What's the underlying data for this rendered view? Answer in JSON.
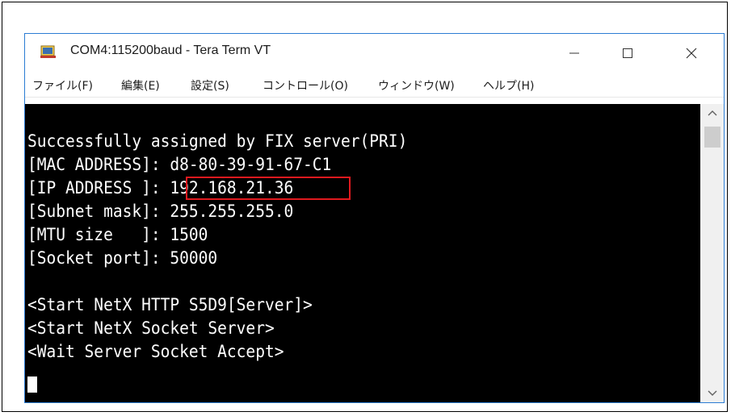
{
  "window": {
    "title": "COM4:115200baud - Tera Term VT"
  },
  "menu": {
    "items": [
      {
        "label": "ファイル(F)"
      },
      {
        "label": "編集(E)"
      },
      {
        "label": "設定(S)"
      },
      {
        "label": "コントロール(O)"
      },
      {
        "label": "ウィンドウ(W)"
      },
      {
        "label": "ヘルプ(H)"
      }
    ]
  },
  "terminal": {
    "lines": [
      "Successfully assigned by FIX server(PRI)",
      "[MAC ADDRESS]: d8-80-39-91-67-C1",
      "[IP ADDRESS ]: 192.168.21.36",
      "[Subnet mask]: 255.255.255.0",
      "[MTU size   ]: 1500",
      "[Socket port]: 50000",
      "",
      "<Start NetX HTTP S5D9[Server]>",
      "<Start NetX Socket Server>",
      "<Wait Server Socket Accept>"
    ],
    "highlighted_value": "192.168.21.36"
  },
  "colors": {
    "terminal_bg": "#000000",
    "terminal_fg": "#ffffff",
    "highlight_border": "#e0191e",
    "window_border": "#2b7cd3"
  },
  "icons": {
    "app": "tera-term-icon",
    "minimize": "minimize-icon",
    "maximize": "maximize-icon",
    "close": "close-icon",
    "scroll_up": "chevron-up-icon",
    "scroll_down": "chevron-down-icon"
  }
}
